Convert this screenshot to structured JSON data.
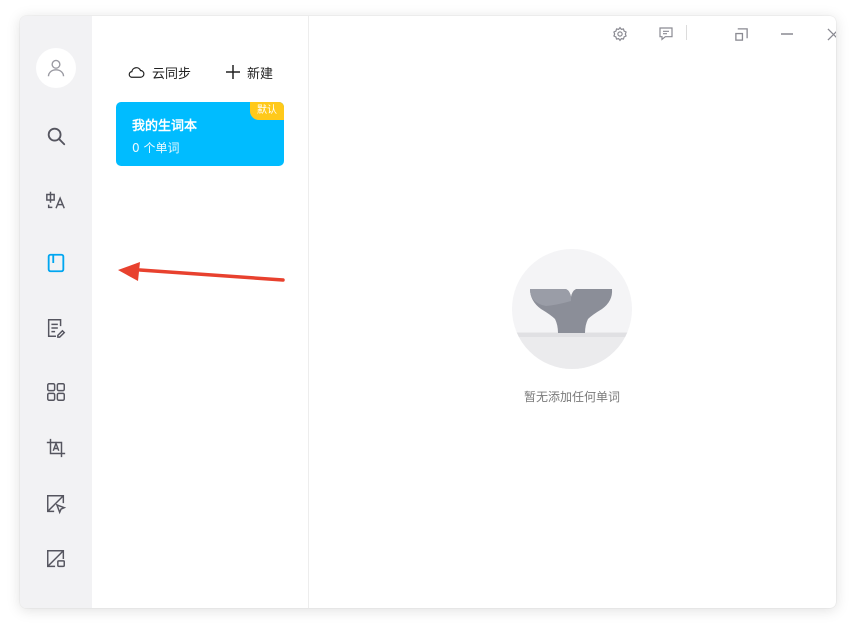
{
  "sidebar": {
    "items": [
      {
        "name": "search"
      },
      {
        "name": "translate"
      },
      {
        "name": "wordbook"
      },
      {
        "name": "notes"
      },
      {
        "name": "apps"
      },
      {
        "name": "ocr"
      },
      {
        "name": "screenshot-translate"
      },
      {
        "name": "screenshot"
      }
    ],
    "active": "wordbook"
  },
  "wordbook_list": {
    "sync_label": "云同步",
    "new_label": "新建",
    "books": [
      {
        "title": "我的生词本",
        "count": "0 个单词",
        "badge": "默认"
      }
    ]
  },
  "main": {
    "empty_text": "暂无添加任何单词"
  },
  "colors": {
    "accent": "#00bcff",
    "badge": "#ffc91a",
    "annotation_arrow": "#e8412e"
  }
}
